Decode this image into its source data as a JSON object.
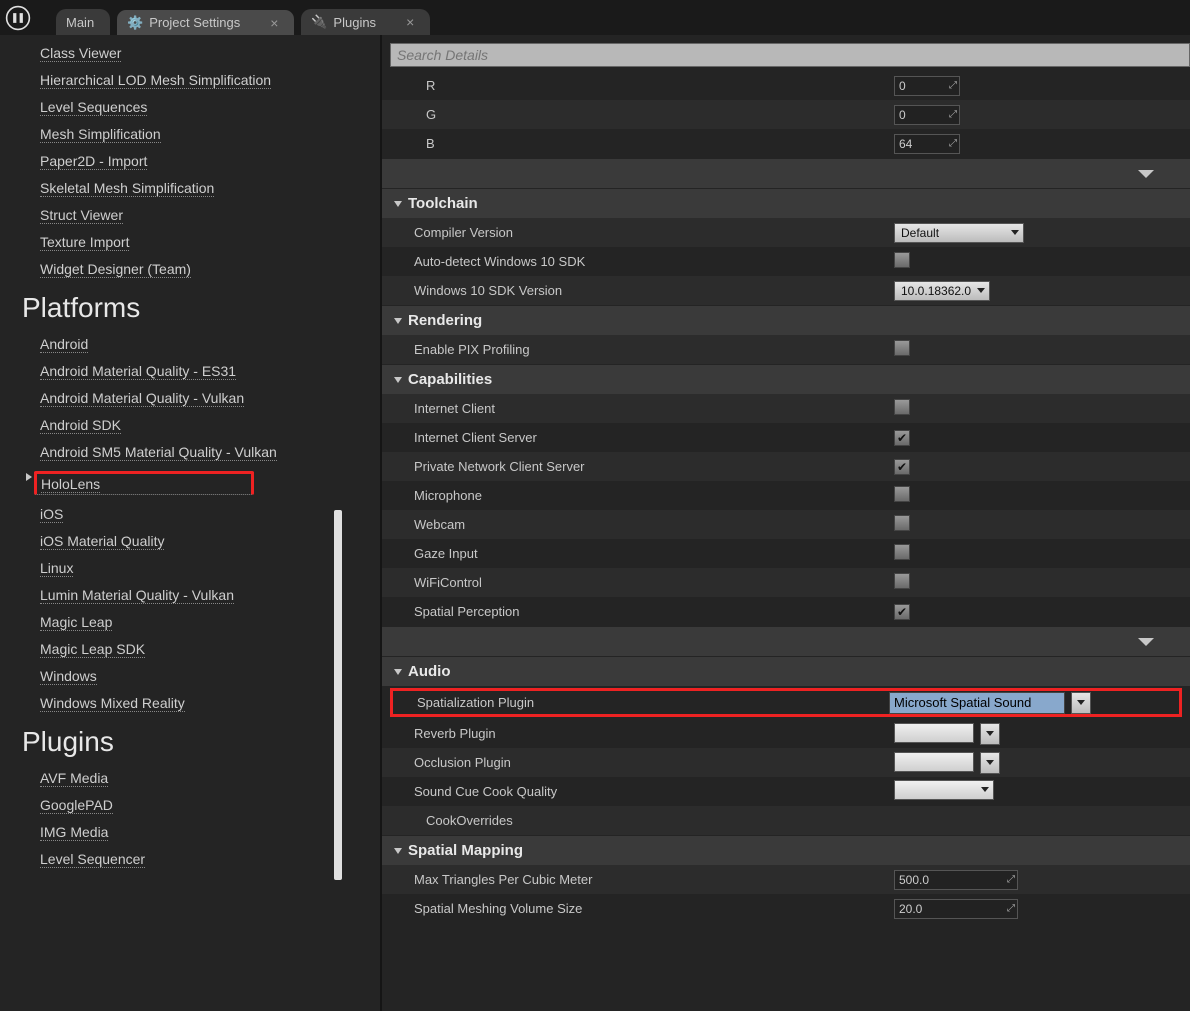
{
  "tabs": {
    "main": "Main",
    "settings": "Project Settings",
    "plugins": "Plugins"
  },
  "search": {
    "placeholder": "Search Details"
  },
  "sidebar": {
    "editor_items": [
      "Class Viewer",
      "Hierarchical LOD Mesh Simplification",
      "Level Sequences",
      "Mesh Simplification",
      "Paper2D - Import",
      "Skeletal Mesh Simplification",
      "Struct Viewer",
      "Texture Import",
      "Widget Designer (Team)"
    ],
    "group_platforms": "Platforms",
    "platform_items": [
      "Android",
      "Android Material Quality - ES31",
      "Android Material Quality - Vulkan",
      "Android SDK",
      "Android SM5 Material Quality - Vulkan",
      "HoloLens",
      "iOS",
      "iOS Material Quality",
      "Linux",
      "Lumin Material Quality - Vulkan",
      "Magic Leap",
      "Magic Leap SDK",
      "Windows",
      "Windows Mixed Reality"
    ],
    "group_plugins": "Plugins",
    "plugin_items": [
      "AVF Media",
      "GooglePAD",
      "IMG Media",
      "Level Sequencer"
    ]
  },
  "rgb": {
    "r_label": "R",
    "g_label": "G",
    "b_label": "B",
    "r": "0",
    "g": "0",
    "b": "64"
  },
  "sections": {
    "toolchain": "Toolchain",
    "rendering": "Rendering",
    "capabilities": "Capabilities",
    "audio": "Audio",
    "spatial_mapping": "Spatial Mapping"
  },
  "toolchain": {
    "compiler_label": "Compiler Version",
    "compiler_value": "Default",
    "autodetect_label": "Auto-detect Windows 10 SDK",
    "sdk_label": "Windows 10 SDK Version",
    "sdk_value": "10.0.18362.0"
  },
  "rendering": {
    "pix_label": "Enable PIX Profiling"
  },
  "capabilities": {
    "items": [
      {
        "label": "Internet Client",
        "checked": false
      },
      {
        "label": "Internet Client Server",
        "checked": true
      },
      {
        "label": "Private Network Client Server",
        "checked": true
      },
      {
        "label": "Microphone",
        "checked": false
      },
      {
        "label": "Webcam",
        "checked": false
      },
      {
        "label": "Gaze Input",
        "checked": false
      },
      {
        "label": "WiFiControl",
        "checked": false
      },
      {
        "label": "Spatial Perception",
        "checked": true
      }
    ]
  },
  "audio": {
    "spat_label": "Spatialization Plugin",
    "spat_value": "Microsoft Spatial Sound",
    "reverb_label": "Reverb Plugin",
    "occ_label": "Occlusion Plugin",
    "cue_label": "Sound Cue Cook Quality",
    "cook_label": "CookOverrides"
  },
  "spatmap": {
    "tri_label": "Max Triangles Per Cubic Meter",
    "tri_value": "500.0",
    "vol_label": "Spatial Meshing Volume Size",
    "vol_value": "20.0"
  }
}
